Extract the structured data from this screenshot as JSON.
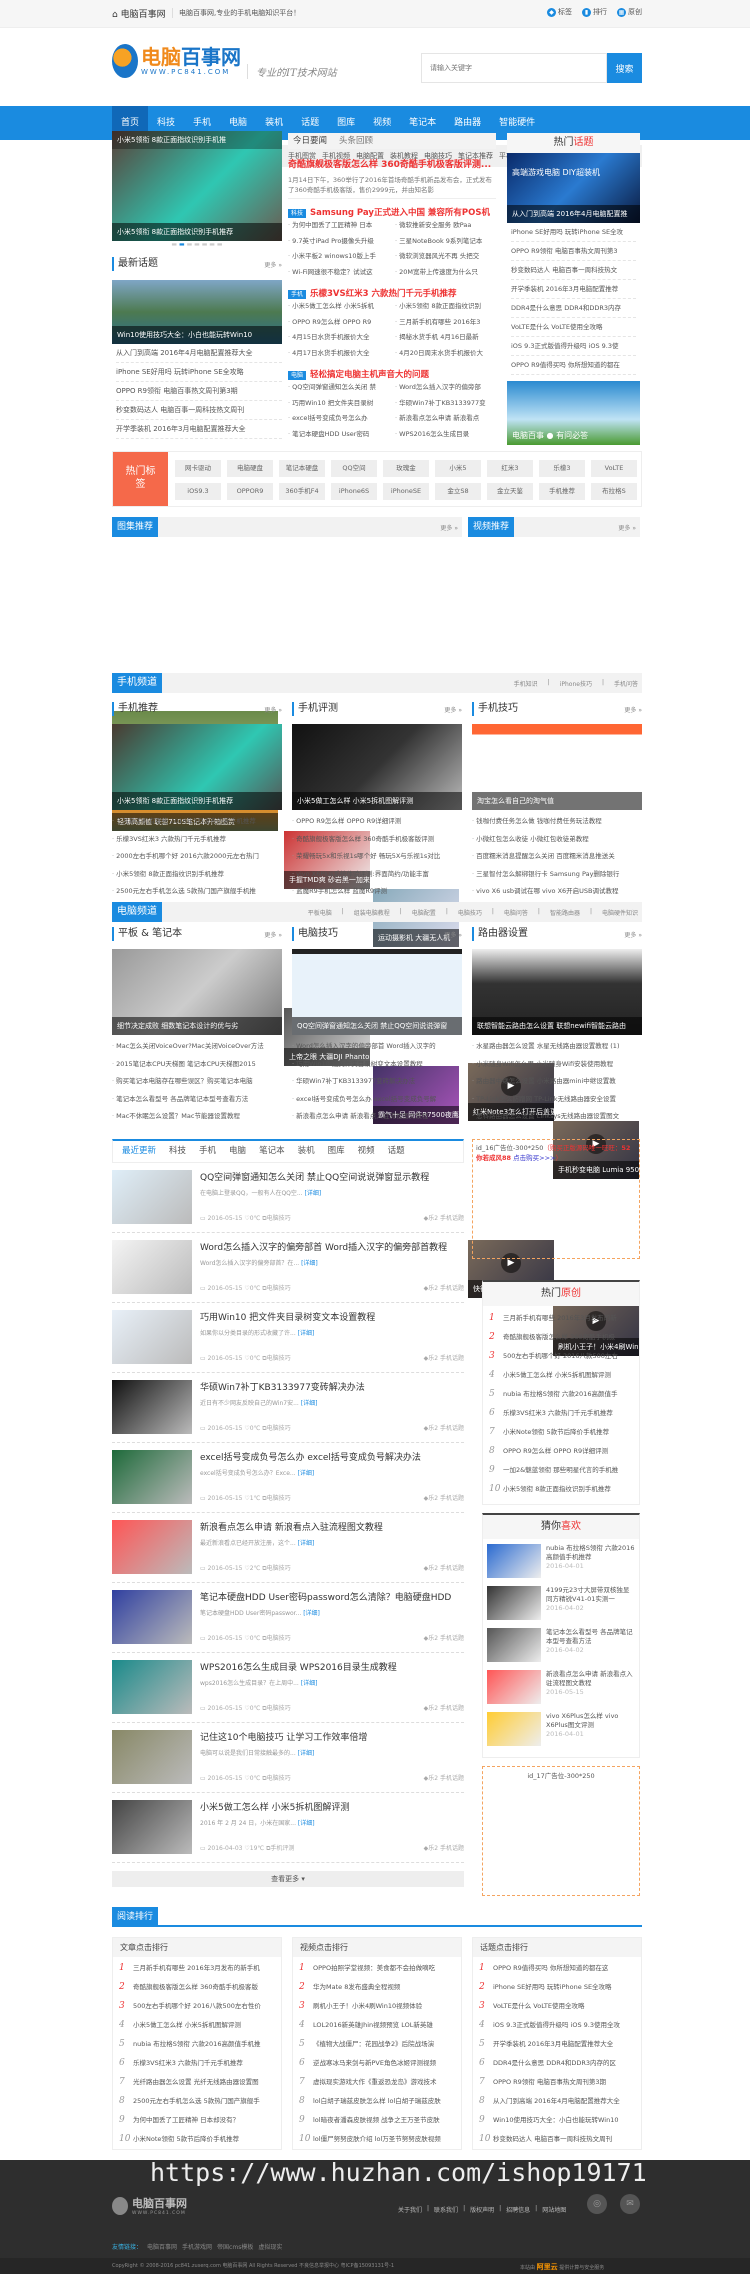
{
  "topbar": {
    "home": "电脑百事网",
    "slogan": "电脑百事网,专业的手机电脑知识平台！",
    "links": [
      "标签",
      "排行",
      "原创"
    ]
  },
  "header": {
    "logo_cn1": "电脑",
    "logo_cn2": "百事网",
    "logo_en": "WWW.PC841.COM",
    "motto": "专业的IT技术网站",
    "search_placeholder": "请输入关键字",
    "search_btn": "搜索"
  },
  "nav": [
    "首页",
    "科技",
    "手机",
    "电脑",
    "装机",
    "话题",
    "图库",
    "视频",
    "笔记本",
    "路由器",
    "智能硬件"
  ],
  "subnav": [
    "手机推荐",
    "手机评测",
    "手机技巧",
    "手机知识",
    "手机问答",
    "手机图赏",
    "手机视频",
    "电脑配置",
    "装机教程",
    "电脑技巧",
    "笔记本推荐",
    "平板电脑",
    "Ps教程"
  ],
  "slider": {
    "top": "小米5领衔 8款正面指纹识别手机推",
    "caption": "小米5领衔 8款正面指纹识别手机推荐"
  },
  "topics": {
    "title": "最新话题",
    "more": "更多 »",
    "img_caption": "Win10使用技巧大全：小白也能玩转Win10",
    "items": [
      "从入门到高端 2016年4月电脑配置推荐大全",
      "iPhone SE好用吗 玩转iPhone SE全攻略",
      "OPPO R9领衔 电脑百事热文周刊第3期",
      "秒变数码达人 电脑百事一周科技热文周刊",
      "开学季装机 2016年3月电脑配置推荐大全"
    ]
  },
  "news": {
    "tabs": [
      "今日要闻",
      "头条回顾"
    ],
    "headline": "奇酷旗舰极客版怎么样 360奇酷手机极客版评测...",
    "summary": "1月14日下午，360举行了2016年首场奇酷手机新品发布会，正式发布了360奇酷手机极客版，售价2999元，并由知名影",
    "groups": [
      {
        "tag": "科技",
        "title": "Samsung Pay正式进入中国 兼容所有POS机",
        "items": [
          "为何中国丢了工匠精神 日本",
          "微软推新安全服务 欧Paa",
          "9.7英寸iPad Pro摄像头升级",
          "三星NoteBook 9系列笔记本",
          "小米平板2 winows10版上手",
          "微软浏览器风光不再 头把交",
          "Wi-Fi网速很不稳定？试试这",
          "20M宽带上传速度为什么只"
        ]
      },
      {
        "tag": "手机",
        "title": "乐檬3VS红米3 六款热门千元手机推荐",
        "items": [
          "小米5做工怎么样 小米5拆机",
          "小米5领衔 8款正面指纹识别",
          "OPPO R9怎么样 OPPO R9",
          "三月新手机有哪些 2016年3",
          "4月15日水货手机报价大全",
          "揭秘水货手机 4月16日最新",
          "4月17日水货手机报价大全",
          "4月20日周末水货手机报价大"
        ]
      },
      {
        "tag": "电脑",
        "title": "轻松搞定电脑主机声音大的问题",
        "items": [
          "QQ空间弹窗通知怎么关闭 禁",
          "Word怎么插入汉字的偏旁部",
          "巧用Win10 把文件夹目录树",
          "华硕Win7补丁KB3133977变",
          "excel括号变成负号怎么办",
          "新浪看点怎么申请 新浪看点",
          "笔记本硬盘HDD User密码",
          "WPS2016怎么生成目录"
        ]
      }
    ]
  },
  "hot": {
    "title1": "热门",
    "title2": "话题",
    "img_caption": "从入门到高端 2016年4月电脑配置推",
    "img_text": "高端游戏电脑 DIY超装机",
    "items": [
      "iPhone SE好用吗 玩转iPhone SE全攻",
      "OPPO R9领衔 电脑百事热文周刊第3",
      "秒变数码达人 电脑百事一周科技热文",
      "开学季装机 2016年3月电脑配置推荐",
      "DDR4是什么意思 DDR4和DDR3内存",
      "VoLTE是什么 VoLTE使用全攻略",
      "iOS 9.3正式版值得升级吗 iOS 9.3使",
      "OPPO R9值得买吗 你所想知道的都在"
    ],
    "banner": "电脑百事 ● 有问必答"
  },
  "hottags": {
    "label": "热门标签",
    "tags": [
      "网卡驱动",
      "电脑硬盘",
      "笔记本硬盘",
      "QQ空间",
      "玫瑰金",
      "小米5",
      "红米3",
      "乐檬3",
      "VoLTE",
      "iOS9.3",
      "OPPOR9",
      "360手机F4",
      "iPhone6S",
      "iPhoneSE",
      "金立S8",
      "金立天鉴",
      "手机推荐",
      "布拉格S"
    ]
  },
  "gallery": {
    "title": "图集推荐",
    "more": "更多 »",
    "big": "轻薄高颜值 联想710S笔记本开箱图赏",
    "items": [
      "手握TMD爽 砂岩黑一加来电",
      "运动摄影机 大疆无人机",
      "上帝之眼 大疆DJI Phantom",
      "霸气十足 网件R7500夜鹰"
    ]
  },
  "video": {
    "title": "视频推荐",
    "more": "更多 »",
    "items": [
      "红米Note3怎么打开后盖更",
      "手机秒变电脑 Lumia 950XL",
      "快得有点狠 小米5体验评测",
      "刷机小王子！小米4刷Win10"
    ]
  },
  "phone": {
    "title": "手机频道",
    "links": [
      "手机知识",
      "iPhone技巧",
      "手机问答"
    ],
    "cols": [
      {
        "title": "手机推荐",
        "more": "更多 »",
        "caption": "小米5领衔 8款正面指纹识别手机推荐",
        "items": [
          "三月新手机有哪些 2016年3月发布的新手机推荐",
          "乐檬3VS红米3 六款热门千元手机推荐",
          "2000左右手机哪个好 2016六款2000元左右热门",
          "小米5领衔 8款正面指纹识别手机推荐",
          "2500元左右手机怎么选 5款热门国产旗舰手机推"
        ]
      },
      {
        "title": "手机评测",
        "more": "更多 »",
        "caption": "小米5做工怎么样 小米5拆机图解评测",
        "items": [
          "OPPO R9怎么样 OPPO R9详细评测",
          "奇酷旗舰极客版怎么样 360奇酷手机极客版评测",
          "荣耀畅玩5x和乐视1s哪个好 畅玩5X与乐视1s对比",
          "vivo X6Plus系统体验评测:界面简约/功能丰富",
          "蓝魔R9手机怎么样 蓝魔R9评测"
        ]
      },
      {
        "title": "手机技巧",
        "more": "更多 »",
        "caption": "淘宝怎么看自己的淘气值",
        "items": [
          "钱咖付费任务怎么做 钱咖付费任务玩法教程",
          "小微红包怎么收徒 小微红包收徒弟教程",
          "百度糯米消息提醒怎么关闭 百度糯米消息推送关",
          "三星智付怎么解绑银行卡 Samsung Pay删除银行",
          "vivo X6 usb调试在哪 vivo X6开启USB调试教程"
        ]
      }
    ]
  },
  "pc": {
    "title": "电脑频道",
    "links": [
      "平板电脑",
      "组装电脑教程",
      "电脑配置",
      "电脑技巧",
      "电脑问答",
      "智能路由器",
      "电脑硬件知识"
    ],
    "cols": [
      {
        "title": "平板 & 笔记本",
        "more": "更多 »",
        "caption": "细节决定成败 细数笔记本设计的优与劣",
        "items": [
          "Mac怎么关闭VoiceOver?Mac关闭VoiceOver方法",
          "2015笔记本CPU天梯图 笔记本CPU天梯图2015",
          "购买笔记本电脑存在哪些误区？购买笔记本电脑",
          "笔记本怎么看型号 各品牌笔记本型号查看方法",
          "Mac不休眠怎么设置？Mac节能器设置教程"
        ]
      },
      {
        "title": "电脑技巧",
        "more": "更多 »",
        "caption": "QQ空间弹窗通知怎么关闭 禁止QQ空间说说弹窗",
        "items": [
          "Word怎么插入汉字的偏旁部首 Word插入汉字的",
          "巧用Win10 把文件夹目录树变文本设置教程",
          "华硕Win7补丁KB3133977变砖解决办法",
          "excel括号变成负号怎么办 excel括号变成负号解",
          "新浪看点怎么申请 新浪看点入驻流程图文教程"
        ]
      },
      {
        "title": "路由器设置",
        "more": "更多 »",
        "caption": "联想智能云路由怎么设置 联想newifi智能云路由",
        "items": [
          "水星路由器怎么设置 水星无线路由器设置教程 (1)",
          "小米随身Wifi怎么用 小米随身Wifi安装使用教程",
          "路由器中继怎么设置 小米路由器mini中继设置教",
          "TP-Link怎么防蹭网 TP-Link无线路由器安全设置",
          "思科路由器怎么设置 Linksys无线路由器设置图文"
        ]
      }
    ]
  },
  "latest": {
    "tabs": [
      "最近更新",
      "科技",
      "手机",
      "电脑",
      "笔记本",
      "装机",
      "图库",
      "视频",
      "话题"
    ],
    "detail": "[详细]",
    "tagline": "乐2",
    "tagcat": "手机话题",
    "load_more": "查看更多 ▾",
    "articles": [
      {
        "title": "QQ空间弹窗通知怎么关闭 禁止QQ空间说说弹窗显示教程",
        "summary": "在电脑上登录QQ，一般有人在QQ空...",
        "date": "2016-05-15",
        "likes": "0℃",
        "cat": "电脑技巧"
      },
      {
        "title": "Word怎么插入汉字的偏旁部首 Word插入汉字的偏旁部首教程",
        "summary": "Word怎么插入汉字的偏旁部首？在...",
        "date": "2016-05-15",
        "likes": "0℃",
        "cat": "电脑技巧"
      },
      {
        "title": "巧用Win10 把文件夹目录树变文本设置教程",
        "summary": "如果你以分类目录的形式收藏了许...",
        "date": "2016-05-15",
        "likes": "0℃",
        "cat": "电脑技巧"
      },
      {
        "title": "华硕Win7补丁KB3133977变砖解决办法",
        "summary": "近日有不少网友反映自己的Win7安...",
        "date": "2016-05-15",
        "likes": "0℃",
        "cat": "电脑技巧"
      },
      {
        "title": "excel括号变成负号怎么办 excel括号变成负号解决办法",
        "summary": "excel括号变成负号怎么办？Exce...",
        "date": "2016-05-15",
        "likes": "1℃",
        "cat": "电脑技巧"
      },
      {
        "title": "新浪看点怎么申请 新浪看点入驻流程图文教程",
        "summary": "最近新浪看点已经开放注册，这个...",
        "date": "2016-05-15",
        "likes": "2℃",
        "cat": "电脑技巧"
      },
      {
        "title": "笔记本硬盘HDD User密码password怎么清除？电脑硬盘HDD",
        "summary": "笔记本硬盘HDD User密码passwor...",
        "date": "2016-05-15",
        "likes": "0℃",
        "cat": "电脑技巧"
      },
      {
        "title": "WPS2016怎么生成目录 WPS2016目录生成教程",
        "summary": "wps2016怎么生成目录？在上周中...",
        "date": "2016-05-15",
        "likes": "0℃",
        "cat": "电脑技巧"
      },
      {
        "title": "记住这10个电脑技巧 让学习工作效率倍增",
        "summary": "电脑可以说是我们日常接触最多的...",
        "date": "2016-05-15",
        "likes": "0℃",
        "cat": "电脑技巧"
      },
      {
        "title": "小米5做工怎么样 小米5拆机图解评测",
        "summary": "2016 年 2 月 24 日，小米在国家...",
        "date": "2016-04-03",
        "likes": "19℃",
        "cat": "手机评测"
      }
    ]
  },
  "ad16": {
    "a": "id_16广告位-300*250",
    "b": "（购买正版源码唯一旺旺：",
    "c": "52你若成风88",
    "d": "点击购买>>>",
    "e": "）"
  },
  "original": {
    "t1": "热门",
    "t2": "原创",
    "items": [
      "三月新手机有哪些 2016年3月发布的新",
      "奇酷旗舰极客版怎么样 360奇酷手机极",
      "500左右手机哪个好 2016八款500左右",
      "小米5做工怎么样 小米5拆机图解评测",
      "nubia 布拉格S领衔 六款2016高颜值手",
      "乐檬3VS红米3 六款热门千元手机推荐",
      "小米Note领衔 5款节后降价手机推荐",
      "OPPO R9怎么样 OPPO R9详细评测",
      "一加2&魅蓝领衔 那些明星代言的手机推",
      "小米5领衔 8款正面指纹识别手机推荐"
    ]
  },
  "guess": {
    "t1": "猜你",
    "t2": "喜欢",
    "items": [
      {
        "t": "nubia 布拉格S领衔 六款2016高颜值手机推荐",
        "d": "2016-04-01"
      },
      {
        "t": "4199元23寸大屏带双核独显同方精锐V41-01实测一",
        "d": "2016-04-02"
      },
      {
        "t": "笔记本怎么看型号 各品牌笔记本型号查看方法",
        "d": "2016-04-02"
      },
      {
        "t": "新浪看点怎么申请 新浪看点入驻流程图文教程",
        "d": "2016-05-15"
      },
      {
        "t": "vivo X6Plus怎么样 vivo X6Plus图文评测",
        "d": "2016-04-01"
      }
    ]
  },
  "ad17": "id_17广告位-300*250",
  "ranking": {
    "title": "阅读排行",
    "cols": [
      {
        "title": "文章点击排行",
        "items": [
          "三月新手机有哪些 2016年3月发布的新手机",
          "奇酷旗舰极客版怎么样 360奇酷手机极客版",
          "500左右手机哪个好 2016八款500左右性价",
          "小米5做工怎么样 小米5拆机图解评测",
          "nubia 布拉格S领衔 六款2016高颜值手机推",
          "乐檬3VS红米3 六款热门千元手机推荐",
          "光纤路由器怎么设置 光纤无线路由器设置图",
          "2500元左右手机怎么选 5款热门国产旗舰手",
          "为何中国丢了工匠精神 日本却没有？",
          "小米Note领衔 5款节后降价手机推荐"
        ]
      },
      {
        "title": "视频点击排行",
        "items": [
          "OPPO拍照学堂视频：美食都不会拍做嘀吃",
          "华为Mate 8发布盛典全程视频",
          "刷机小王子！小米4刷Win10视频体验",
          "LOL2016新英雄Jhin视频预览 LOL新英雄",
          "《植物大战僵尸：花园战争2》后院战场演",
          "逆战寒冰马来剑与新PVE角色冰姬评测视频",
          "虚拟现实游戏大作《重返恐龙岛》游戏技术",
          "lol白胡子瑞兹皮肤怎么样 lol白胡子瑞兹皮肤",
          "lol暗夜者潘森皮肤视频 战争之王万圣节皮肤",
          "lol僵尸努努皮肤介绍 lol万圣节努努皮肤视频"
        ]
      },
      {
        "title": "话题点击排行",
        "items": [
          "OPPO R9值得买吗 你所想知道的都在这",
          "iPhone SE好用吗 玩转iPhone SE全攻略",
          "VoLTE是什么 VoLTE使用全攻略",
          "iOS 9.3正式版值得升级吗 iOS 9.3使用全攻",
          "开学季装机 2016年3月电脑配置推荐大全",
          "DDR4是什么意思 DDR4和DDR3内存的区",
          "OPPO R9领衔 电脑百事热文周刊第3期",
          "从入门到高端 2016年4月电脑配置推荐大全",
          "Win10使用技巧大全：小白也能玩转Win10",
          "秒变数码达人 电脑百事一周科技热文周刊"
        ]
      }
    ]
  },
  "watermark": "https://www.huzhan.com/ishop19171",
  "footer": {
    "logo": "电脑百事网",
    "logo_en": "WWW.PC841.COM",
    "links": [
      "关于我们",
      "联系我们",
      "版权声明",
      "招聘信息",
      "网站地图"
    ],
    "friend_label": "友情链接：",
    "friends": [
      "电脑百事网",
      "手机游戏网",
      "帝国cms模板",
      "虚拟现实"
    ],
    "copyright": "CopyRight © 2008-2016 pc841.zuserq.com 电脑百事网 All Rights Reserved 不良信息举报中心 粤ICP备15093131号-1",
    "sitemap": "本站由",
    "cloud": "阿里云",
    "cloud_text": "提供计算与安全服务"
  }
}
